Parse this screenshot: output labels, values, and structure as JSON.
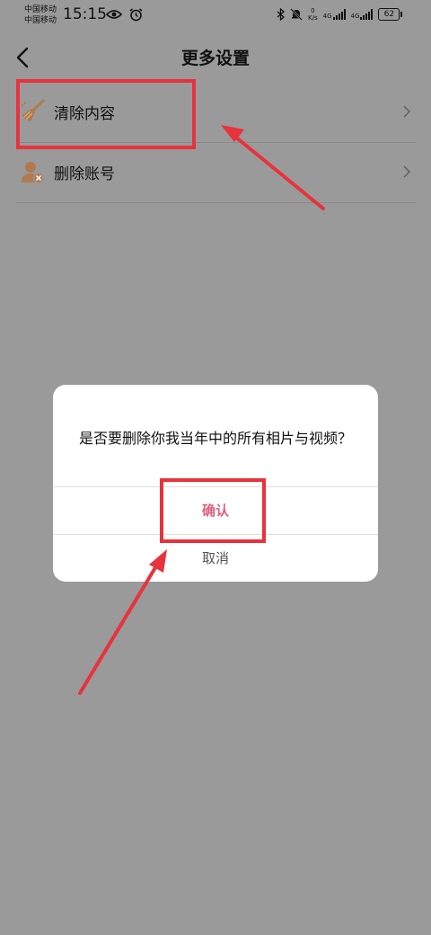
{
  "status_bar": {
    "carrier_1": "中国移动",
    "carrier_2": "中国移动",
    "time": "15:15",
    "net_speed_value": "0",
    "net_speed_unit": "K/s",
    "signal_1": "4G",
    "signal_2": "4G",
    "battery": "62"
  },
  "header": {
    "title": "更多设置"
  },
  "menu": {
    "items": [
      {
        "label": "清除内容",
        "icon": "broom-icon"
      },
      {
        "label": "删除账号",
        "icon": "user-delete-icon"
      }
    ]
  },
  "dialog": {
    "message": "是否要删除你我当年中的所有相片与视频？",
    "confirm": "确认",
    "cancel": "取消"
  },
  "colors": {
    "background": "#9a9a9a",
    "confirm": "#e0607e",
    "annotation": "#e8323c",
    "icon": "#b07a4e"
  }
}
